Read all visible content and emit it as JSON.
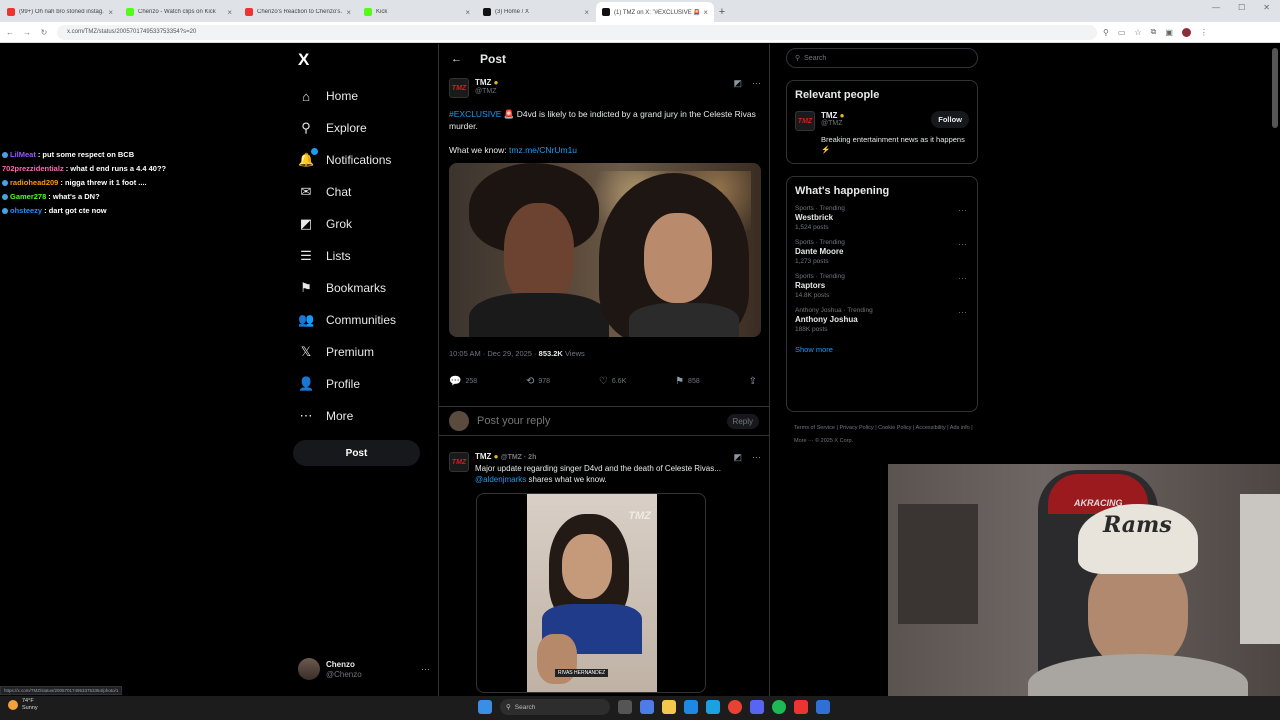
{
  "browser": {
    "tabs": [
      {
        "title": "(99+) Oh nah bro stoned instag...",
        "color": "#e33"
      },
      {
        "title": "Chenzo - Watch clips on Kick",
        "color": "#53fc18"
      },
      {
        "title": "Chenzo's Reaction to Chenzo's...",
        "color": "#e33"
      },
      {
        "title": "Kick",
        "color": "#53fc18"
      },
      {
        "title": "(3) Home / X",
        "color": "#111"
      },
      {
        "title": "(1) TMZ on X: \"#EXCLUSIVE 🚨",
        "color": "#111"
      }
    ],
    "url": "x.com/TMZ/status/2005701749533753354?s=20"
  },
  "chat": [
    {
      "user": "LilMeat",
      "msg": ": put some respect on BCB",
      "color": "#9b59ff"
    },
    {
      "user": "702prezzidentialz",
      "msg": ": what d end runs a 4.4 40??",
      "color": "#ff69b4"
    },
    {
      "user": "radiohead209",
      "msg": ": nigga threw it 1 foot ....",
      "color": "#ff9900"
    },
    {
      "user": "Gamer278",
      "msg": ": what's a DN?",
      "color": "#53fc18"
    },
    {
      "user": "ohsteezy",
      "msg": ": dart got cte now",
      "color": "#1e90ff"
    }
  ],
  "nav": {
    "logo": "X",
    "items": [
      {
        "label": "Home",
        "icon": "⌂"
      },
      {
        "label": "Explore",
        "icon": "⚲"
      },
      {
        "label": "Notifications",
        "icon": "🔔"
      },
      {
        "label": "Chat",
        "icon": "✉"
      },
      {
        "label": "Grok",
        "icon": "◩"
      },
      {
        "label": "Lists",
        "icon": "☰"
      },
      {
        "label": "Bookmarks",
        "icon": "⚑"
      },
      {
        "label": "Communities",
        "icon": "👥"
      },
      {
        "label": "Premium",
        "icon": "𝕏"
      },
      {
        "label": "Profile",
        "icon": "👤"
      },
      {
        "label": "More",
        "icon": "⋯"
      }
    ],
    "post_label": "Post",
    "account": {
      "name": "Chenzo",
      "handle": "@Chenzo"
    }
  },
  "post_page": {
    "title": "Post",
    "tweet": {
      "avatar_text": "TMZ",
      "name": "TMZ",
      "handle": "@TMZ",
      "hashtag": "#EXCLUSIVE",
      "text": "D4vd is likely to be indicted by a grand jury in the Celeste Rivas murder.",
      "know_prefix": "What we know:",
      "link": "tmz.me/CNrUm1u",
      "time": "10:05 AM · Dec 29, 2025 ·",
      "views": "853.2K",
      "views_label": "Views",
      "replies": "258",
      "reposts": "978",
      "likes": "6.6K",
      "bookmarks": "858"
    },
    "reply_placeholder": "Post your reply",
    "reply_button": "Reply",
    "tweet2": {
      "name": "TMZ",
      "meta": "@TMZ · 2h",
      "text": "Major update regarding singer D4vd and the death of Celeste Rivas...",
      "mention": "@aldenjmarks",
      "text2": "shares what we know.",
      "video_caption": "RIVAS HERNANDEZ",
      "watermark": "TMZ"
    }
  },
  "sidebar": {
    "search_placeholder": "Search",
    "relevant_title": "Relevant people",
    "relevant": {
      "name": "TMZ",
      "handle": "@TMZ",
      "bio": "Breaking entertainment news as it happens ⚡",
      "follow_label": "Follow"
    },
    "happening_title": "What's happening",
    "trends": [
      {
        "category": "Sports · Trending",
        "name": "Westbrick",
        "count": "1,524 posts"
      },
      {
        "category": "Sports · Trending",
        "name": "Dante Moore",
        "count": "1,273 posts"
      },
      {
        "category": "Sports · Trending",
        "name": "Raptors",
        "count": "14.8K posts"
      },
      {
        "category": "Anthony Joshua · Trending",
        "name": "Anthony Joshua",
        "count": "188K posts"
      }
    ],
    "show_more": "Show more",
    "footer": "Terms of Service | Privacy Policy | Cookie Policy | Accessibility | Ads info | More ··· © 2025 X Corp."
  },
  "webcam": {
    "chair_text": "AKRACING",
    "hat_text": "Rams"
  },
  "taskbar": {
    "temp": "74°F",
    "weather": "Sunny",
    "search": "Search"
  },
  "status_url": "https://x.com/TMZ/status/2005701749533753354/photo/1"
}
